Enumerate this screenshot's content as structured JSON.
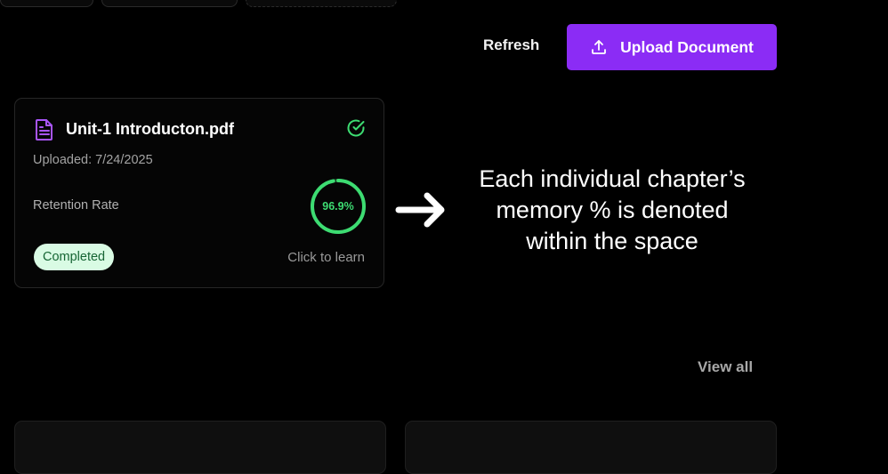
{
  "toolbar": {
    "refresh_label": "Refresh",
    "upload_label": "Upload Document"
  },
  "document_card": {
    "title": "Unit-1 Introducton.pdf",
    "uploaded": "Uploaded: 7/24/2025",
    "retention_label": "Retention Rate",
    "retention_value": "96.9%",
    "retention_fraction": 0.969,
    "status": "Completed",
    "click_to_learn": "Click to learn",
    "icons": {
      "file": "file-text-icon",
      "status": "check-circle-icon"
    }
  },
  "annotation": {
    "line1": "Each individual chapter’s",
    "line2": "memory % is denoted",
    "line3": "within the space"
  },
  "section": {
    "view_all_label": "View all"
  },
  "colors": {
    "background": "#000000",
    "accent": "#8b2cf5",
    "file_icon": "#a855f7",
    "success": "#3ddc72",
    "badge_bg": "#d9fbe4",
    "badge_text": "#166534"
  }
}
